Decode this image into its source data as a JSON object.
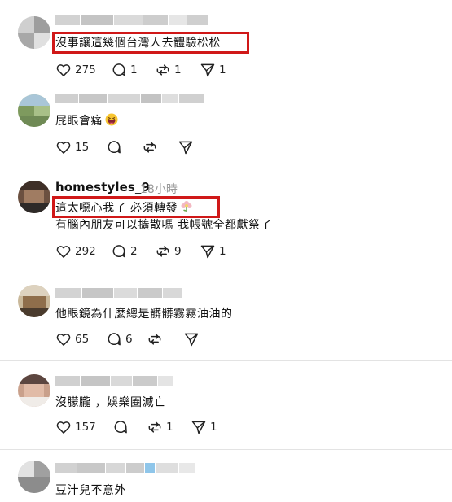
{
  "colors": {
    "highlight": "#d01818",
    "separator": "#e3e3e3",
    "muted": "#9a9a9a"
  },
  "comments": [
    {
      "username": "",
      "time": "",
      "lines": [
        "沒事讓這幾個台灣人去體驗松松"
      ],
      "likes": "275",
      "replies": "1",
      "reposts": "1",
      "shares": "1",
      "highlighted": true
    },
    {
      "username": "",
      "time": "",
      "lines": [
        "屁眼會痛"
      ],
      "emoji": "laughing-face-emoji",
      "likes": "15",
      "replies": "",
      "reposts": "",
      "shares": ""
    },
    {
      "username": "homestyles_9",
      "time": "18小時",
      "lines": [
        "這太噁心我了 必須轉發",
        "有腦內朋友可以擴散嗎 我帳號全都獻祭了"
      ],
      "emoji": "flower-emoji",
      "likes": "292",
      "replies": "2",
      "reposts": "9",
      "shares": "1",
      "highlighted": true
    },
    {
      "username": "",
      "time": "",
      "lines": [
        "他眼鏡為什麼總是髒髒霧霧油油的"
      ],
      "likes": "65",
      "replies": "6",
      "reposts": "",
      "shares": ""
    },
    {
      "username": "",
      "time": "",
      "lines": [
        "沒朦朧 ，娛樂圈滅亡"
      ],
      "likes": "157",
      "replies": "",
      "reposts": "1",
      "shares": "1"
    },
    {
      "username": "",
      "time": "",
      "lines": [
        "豆汁兒不意外"
      ],
      "likes": "",
      "replies": "",
      "reposts": "",
      "shares": ""
    }
  ]
}
